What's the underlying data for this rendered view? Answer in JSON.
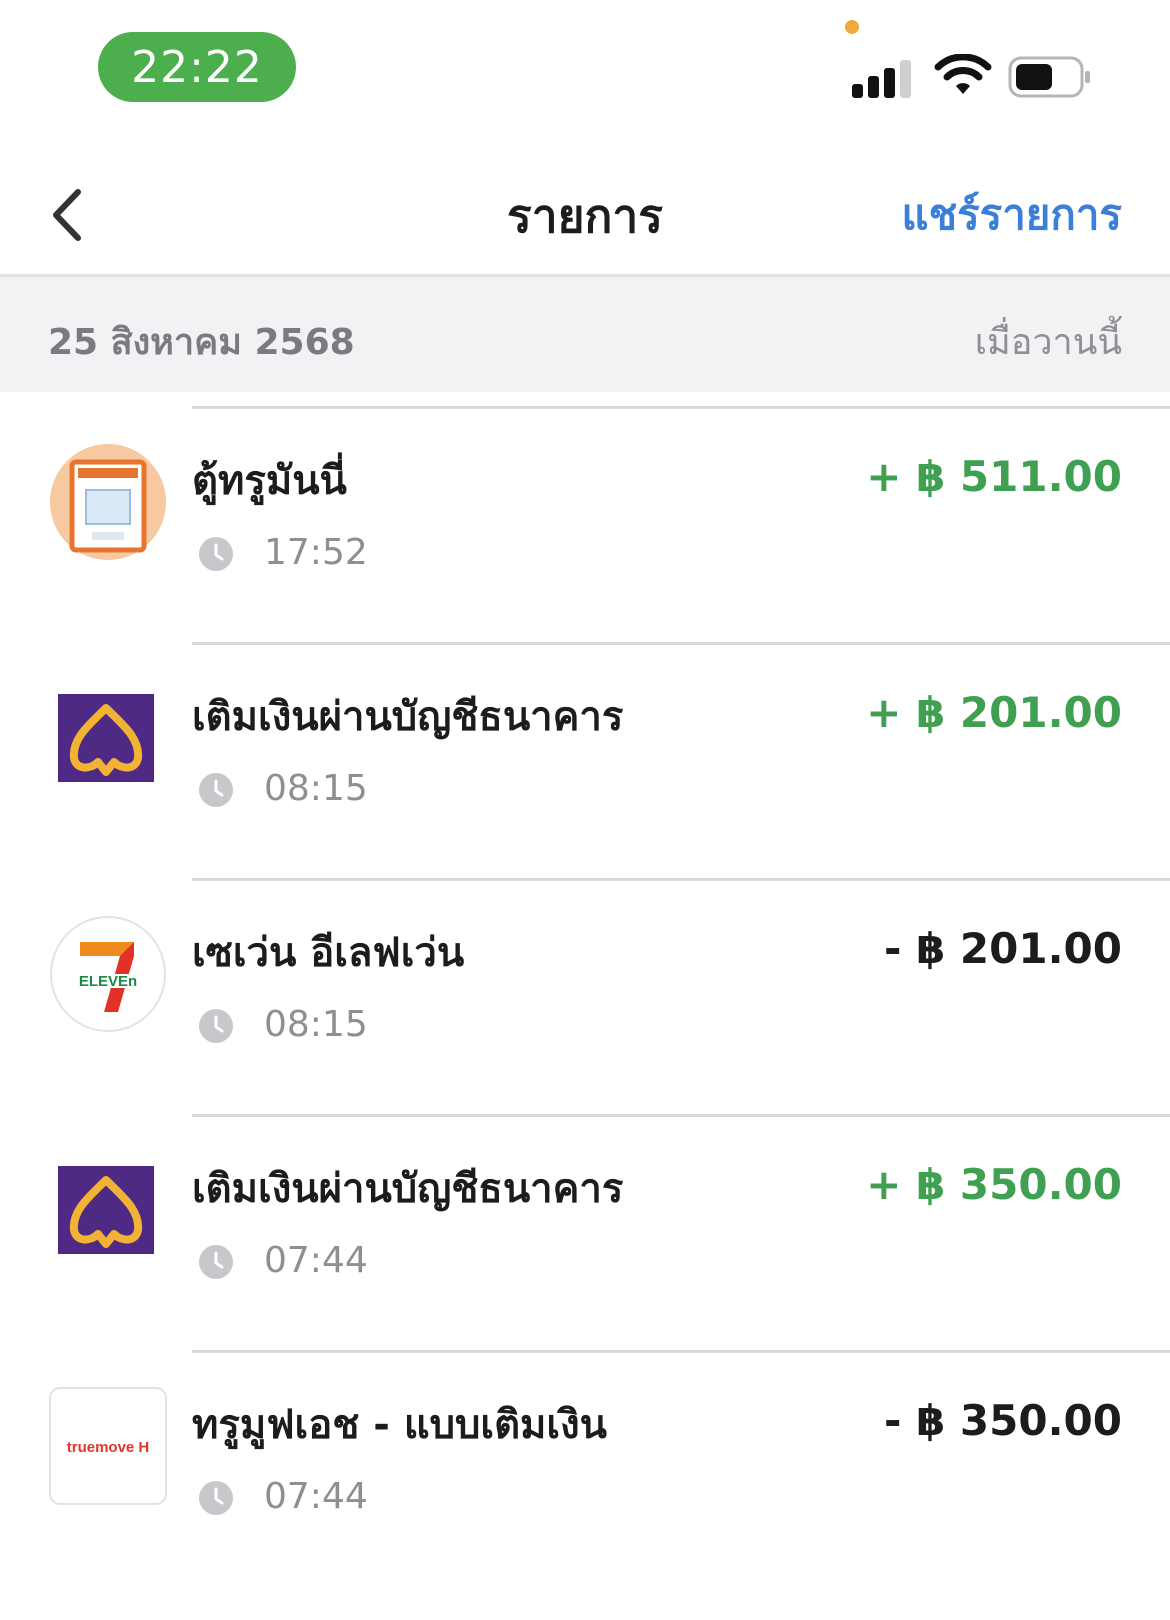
{
  "status_bar": {
    "time": "22:22"
  },
  "nav": {
    "title": "รายการ",
    "share_label": "แชร์รายการ"
  },
  "date_header": {
    "date": "25 สิงหาคม 2568",
    "relative": "เมื่อวานนี้"
  },
  "transactions": [
    {
      "name": "ตู้ทรูมันนี่",
      "time": "17:52",
      "amount": "+ ฿ 511.00",
      "direction": "in",
      "icon": "truemoney-kiosk-icon"
    },
    {
      "name": "เติมเงินผ่านบัญชีธนาคาร",
      "time": "08:15",
      "amount": "+ ฿ 201.00",
      "direction": "in",
      "icon": "bank-logo-icon"
    },
    {
      "name": "เซเว่น อีเลฟเว่น",
      "time": "08:15",
      "amount": "- ฿ 201.00",
      "direction": "out",
      "icon": "seven-eleven-logo-icon",
      "logo_text": "ELEVEn"
    },
    {
      "name": "เติมเงินผ่านบัญชีธนาคาร",
      "time": "07:44",
      "amount": "+ ฿ 350.00",
      "direction": "in",
      "icon": "bank-logo-icon"
    },
    {
      "name": "ทรูมูฟเอช - แบบเติมเงิน",
      "time": "07:44",
      "amount": "- ฿ 350.00",
      "direction": "out",
      "icon": "truemove-logo-icon",
      "logo_text": "truemove H"
    }
  ],
  "colors": {
    "income": "#3fa052",
    "expense": "#1c1c1e",
    "accent": "#3b7fd9",
    "status_pill": "#4cae4c",
    "bank_purple": "#4e2a84",
    "bank_gold": "#f2b233"
  }
}
